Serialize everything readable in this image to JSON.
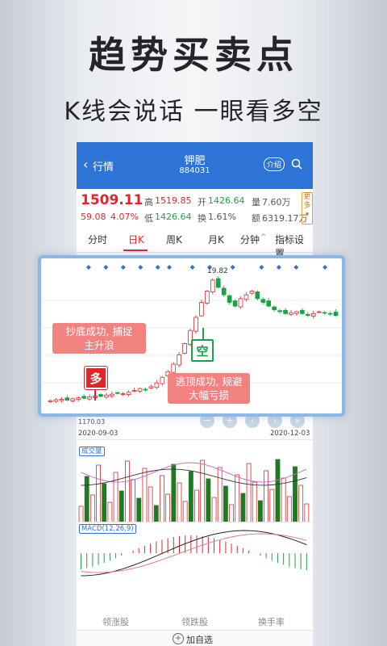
{
  "headline": "趋势买卖点",
  "subline": "K线会说话 一眼看多空",
  "nav": {
    "back_label": "行情",
    "stock_name": "钾肥",
    "stock_code": "884031",
    "intro_label": "介绍"
  },
  "quote": {
    "price": "1509.11",
    "change": "59.08",
    "change_pct": "4.07%",
    "high_label": "高",
    "high": "1519.85",
    "open_label": "开",
    "open": "1426.64",
    "volume_label": "量",
    "volume": "7.60万",
    "low_label": "低",
    "low": "1426.64",
    "turnover_label": "换",
    "turnover": "1.61%",
    "amount_label": "额",
    "amount": "6319.17万",
    "more_label": "更多"
  },
  "tabs": [
    "分时",
    "日K",
    "周K",
    "月K",
    "分钟",
    "指标设置"
  ],
  "active_tab": "日K",
  "chart": {
    "peak_label": "19.82",
    "low_label": "1170.03",
    "date_start": "2020-09-03",
    "date_end": "2020-12-03"
  },
  "bubbles": {
    "buy_text_1": "抄底成功, 捕捉",
    "buy_text_2": "主升浪",
    "sell_text_1": "逃顶成功, 规避",
    "sell_text_2": "大幅亏损",
    "buy_signal": "多",
    "sell_signal": "空"
  },
  "indicators": {
    "volume_label": "成交量",
    "macd_label": "MACD(12,26,9)"
  },
  "bottom": {
    "tabs": [
      "领涨股",
      "领跌股",
      "换手率"
    ],
    "add_label": "加自选"
  },
  "colors": {
    "rise": "#e0262b",
    "fall": "#19a347",
    "accent": "#2e74d6"
  },
  "chart_data": {
    "type": "candlestick",
    "series": [
      {
        "name": "K",
        "values": [
          1175,
          1180,
          1182,
          1178,
          1185,
          1190,
          1188,
          1195,
          1200,
          1198,
          1205,
          1210,
          1215,
          1212,
          1220,
          1230,
          1240,
          1235,
          1250,
          1270,
          1300,
          1330,
          1370,
          1420,
          1480,
          1550,
          1620,
          1700,
          1760,
          1819,
          1780,
          1740,
          1700,
          1680,
          1720,
          1740,
          1760,
          1720,
          1700,
          1680,
          1660,
          1650,
          1640,
          1645,
          1650,
          1640,
          1630,
          1640,
          1650,
          1645,
          1640,
          1630
        ]
      }
    ]
  }
}
